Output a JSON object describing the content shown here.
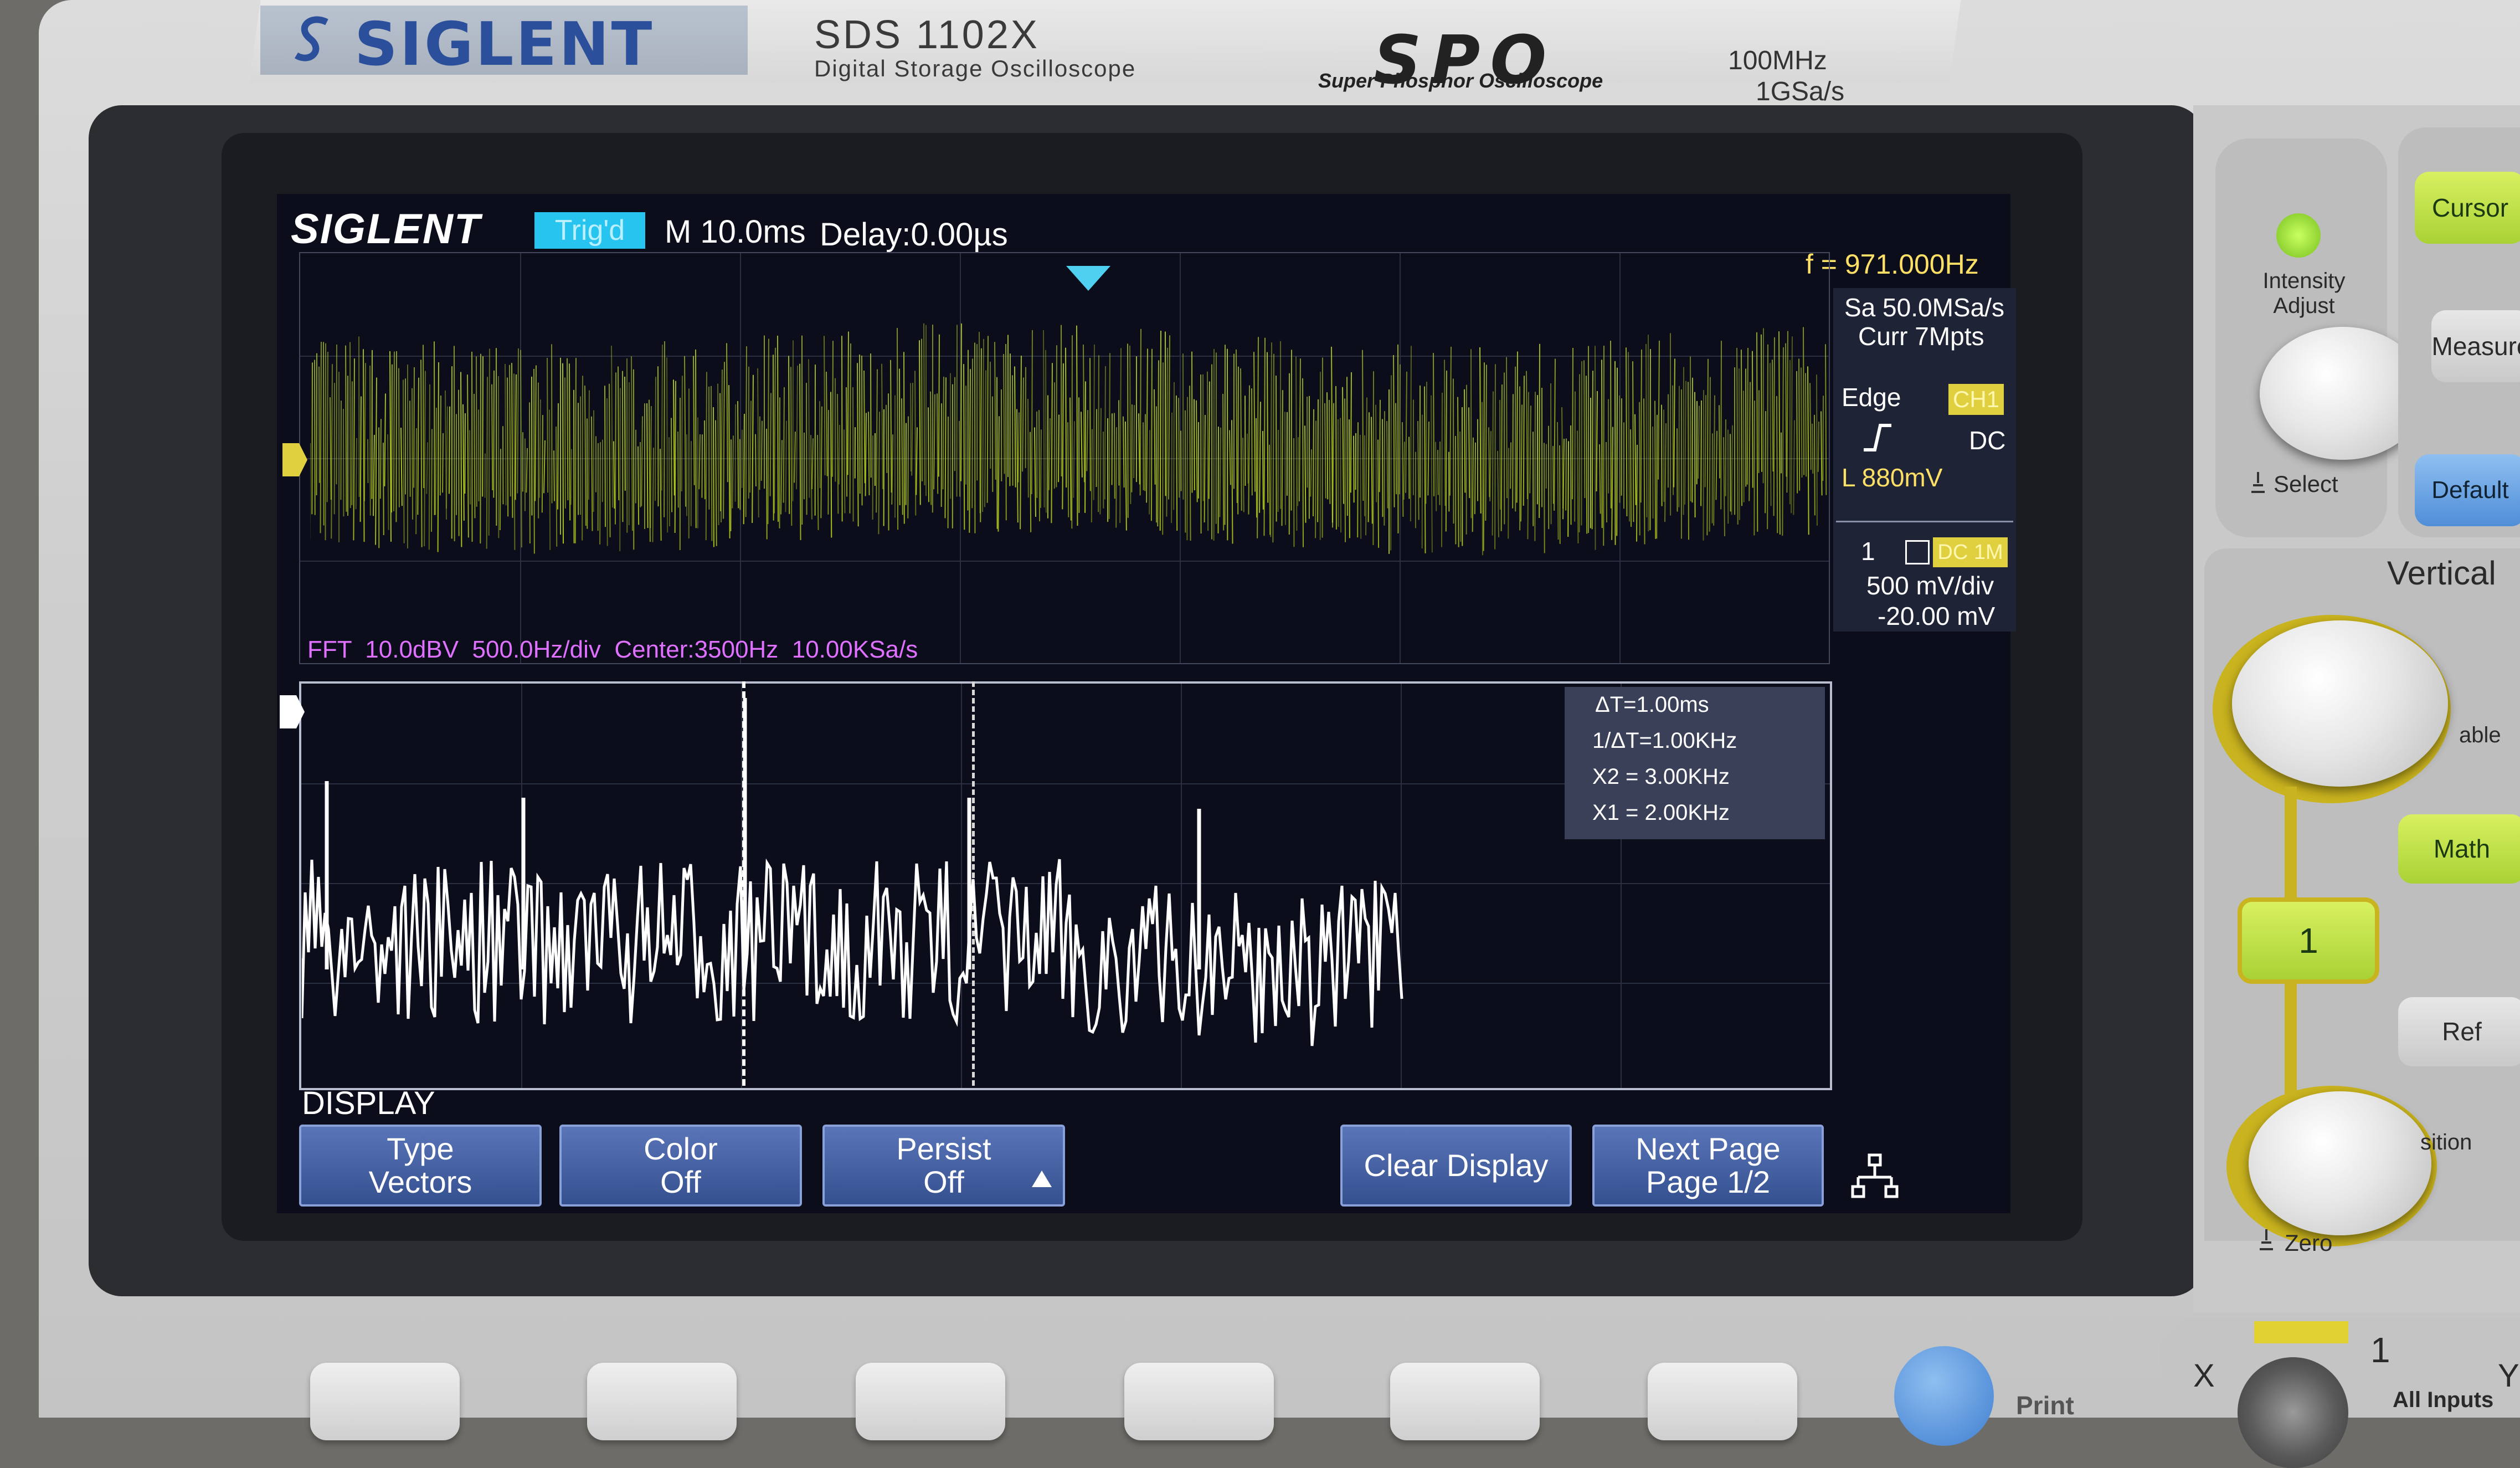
{
  "device": {
    "brand": "SIGLENT",
    "model": "SDS 1102X",
    "subtitle": "Digital Storage Oscilloscope",
    "spo_logo": "SPO",
    "spo_text": "Super Phosphor Oscilloscope",
    "bandwidth": "100MHz",
    "sample_rate": "1GSa/s"
  },
  "screen": {
    "logo": "SIGLENT",
    "trigger_status": "Trig'd",
    "timebase": "M 10.0ms",
    "delay": "Delay:0.00µs",
    "frequency": "f = 971.000Hz",
    "sample_rate": "Sa 50.0MSa/s",
    "memory": "Curr 7Mpts",
    "trigger_type": "Edge",
    "trigger_source": "CH1",
    "trigger_slope_icon": "rising-edge-icon",
    "trigger_coupling": "DC",
    "trigger_level": "L  880mV",
    "channel_number": "1",
    "channel_coupling": "DC 1M",
    "channel_scale": "500 mV/div",
    "channel_offset": "-20.00 mV",
    "fft_label": "FFT  10.0dBV  500.0Hz/div  Center:3500Hz  10.00KSa/s",
    "cursor_delta_t": "ΔT=1.00ms",
    "cursor_inv_delta_t": "1/ΔT=1.00KHz",
    "cursor_x2": "X2 = 3.00KHz",
    "cursor_x1": "X1 = 2.00KHz",
    "menu_title": "DISPLAY",
    "softkeys": [
      {
        "line1": "Type",
        "line2": "Vectors"
      },
      {
        "line1": "Color",
        "line2": "Off"
      },
      {
        "line1": "Persist",
        "line2": "Off"
      },
      {
        "line1": "Clear Display",
        "line2": ""
      },
      {
        "line1": "Next Page",
        "line2": "Page 1/2"
      }
    ],
    "colors": {
      "ch1_trace": "#c8e020",
      "fft_trace": "#ffffff",
      "fft_label": "#e070ff",
      "trigger_marker": "#4fd0f0",
      "softkey": "#4a66a8"
    }
  },
  "panel": {
    "intensity_label": "Intensity\nAdjust",
    "select_label": "Select",
    "cursor_btn": "Cursor",
    "measure_btn": "Measure",
    "default_btn": "Default",
    "vertical_title": "Vertical",
    "variable_label": "able",
    "math_btn": "Math",
    "ch1_btn": "1",
    "ref_btn": "Ref",
    "position_label": "sition",
    "zero_label": "Zero",
    "bottom_1": "1",
    "bottom_x": "X",
    "bottom_y": "Y",
    "all_inputs": "All Inputs",
    "print_label": "Print"
  }
}
